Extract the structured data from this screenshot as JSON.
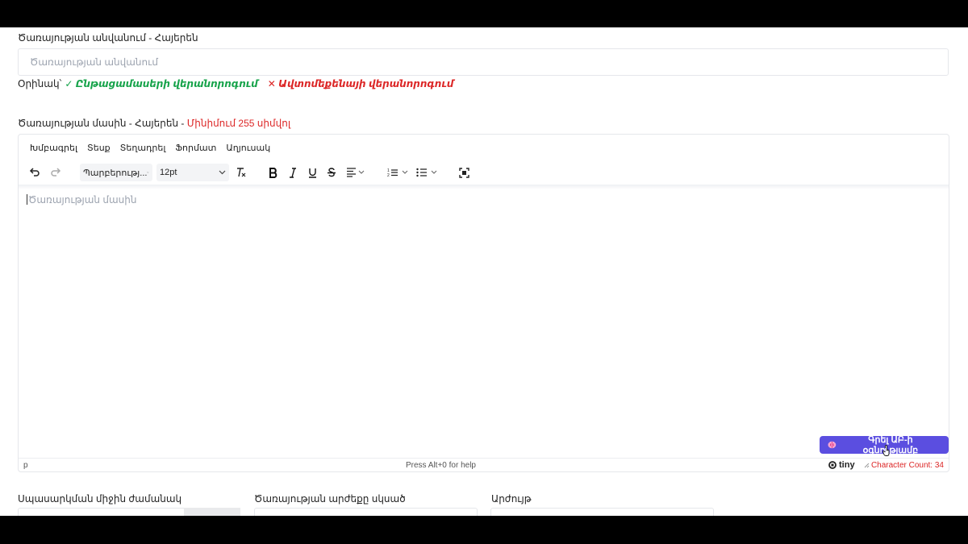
{
  "name_field": {
    "label": "Ծառայության անվանում - Հայերեն",
    "placeholder": "Ծառայության անվանում",
    "example_label": "Օրինակ՝",
    "example_good": "✓ Ընթացամասերի վերանորոգում",
    "example_bad": "✕ Ավտոմեքենայի վերանորոգում"
  },
  "description_field": {
    "label": "Ծառայության մասին - Հայերեն - ",
    "requirement": "Մինիմում 255 սիմվոլ"
  },
  "editor": {
    "menu": [
      "Խմբագրել",
      "Տեսք",
      "Տեղադրել",
      "Ֆորմատ",
      "Աղյուսակ"
    ],
    "font_family": "Պարբերությ...",
    "font_size": "12pt",
    "placeholder": "Ծառայության մասին",
    "status_path": "p",
    "status_help": "Press Alt+0 for help",
    "brand": "tiny",
    "char_count": "Character Count: 34",
    "ai_button": "Գրել ԱԲ-ի օգնությամբ"
  },
  "bottom_fields": {
    "duration_label": "Սպասարկման միջին ժամանակ",
    "price_from_label": "Ծառայության արժեքը սկսած",
    "currency_label": "Արժույթ"
  },
  "colors": {
    "accent": "#5b4ee0",
    "success": "#16a34a",
    "danger": "#dc2626"
  }
}
